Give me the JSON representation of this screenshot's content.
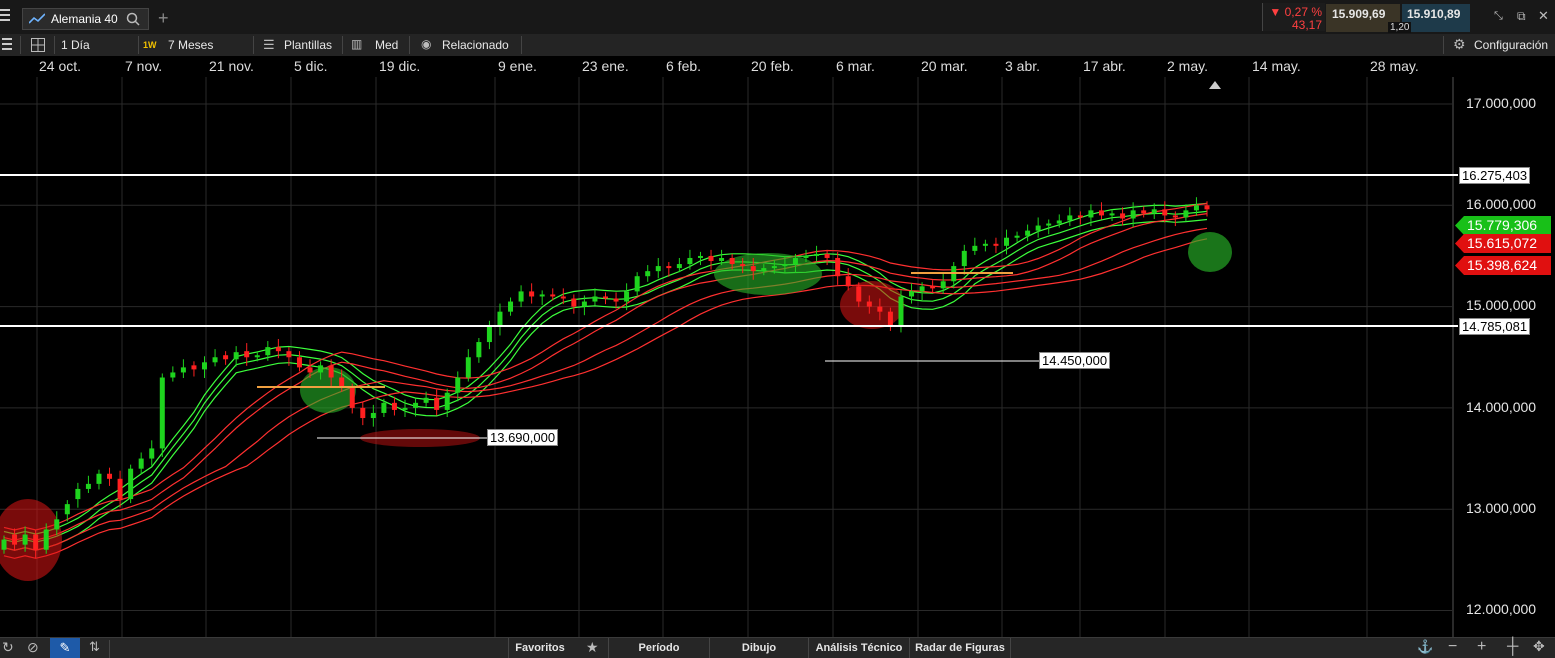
{
  "window": {
    "instrument_tab": "Alemania 40",
    "add_tab_icon": "plus-icon"
  },
  "quote": {
    "change_pct": "▼ 0,27 %",
    "change_pts": "43,17",
    "bid": "15.909,69",
    "ask": "15.910,89",
    "spread": "1,20",
    "colors": {
      "down": "#ff4040",
      "bid_bg": "#3a3426",
      "ask_bg": "#1e3a4a"
    }
  },
  "toolbar": {
    "interval": "1 Día",
    "interval_badge": "1W",
    "range": "7 Meses",
    "templates": "Plantillas",
    "med": "Med",
    "related": "Relacionado",
    "settings": "Configuración"
  },
  "x_axis": {
    "labels": [
      "24 oct.",
      "7 nov.",
      "21 nov.",
      "5 dic.",
      "19 dic.",
      "9 ene.",
      "23 ene.",
      "6 feb.",
      "20 feb.",
      "6 mar.",
      "20 mar.",
      "3 abr.",
      "17 abr.",
      "2 may.",
      "14 may.",
      "28 may."
    ]
  },
  "y_axis": {
    "labels": [
      "17.000,000",
      "16.000,000",
      "15.000,000",
      "14.000,000",
      "13.000,000",
      "12.000,000"
    ]
  },
  "annotations": {
    "resistance": "16.275,403",
    "support": "14.785,081",
    "low1": "13.690,000",
    "low2": "14.450,000"
  },
  "price_tags": {
    "green": "15.779,306",
    "red1": "15.615,072",
    "red2": "15.398,624",
    "colors": {
      "green": "#18c018",
      "red": "#e01010"
    }
  },
  "bottom": {
    "favorites": "Favoritos",
    "period": "Período",
    "drawing": "Dibujo",
    "technical": "Análisis Técnico",
    "patterns": "Radar de Figuras"
  },
  "chart_data": {
    "type": "candlestick",
    "y_range": [
      11950,
      17250
    ],
    "x_labels": [
      "24 oct.",
      "7 nov.",
      "21 nov.",
      "5 dic.",
      "19 dic.",
      "9 ene.",
      "23 ene.",
      "6 feb.",
      "20 feb.",
      "6 mar.",
      "20 mar.",
      "3 abr.",
      "17 abr.",
      "2 may."
    ],
    "close": [
      12700,
      12650,
      12750,
      12600,
      12800,
      12900,
      13050,
      13200,
      13250,
      13350,
      13300,
      13100,
      13400,
      13500,
      13600,
      14300,
      14350,
      14400,
      14380,
      14450,
      14500,
      14480,
      14550,
      14500,
      14520,
      14600,
      14560,
      14500,
      14400,
      14350,
      14420,
      14300,
      14200,
      14000,
      13900,
      13950,
      14050,
      13980,
      14000,
      14050,
      14100,
      13980,
      14150,
      14300,
      14500,
      14650,
      14800,
      14950,
      15050,
      15150,
      15100,
      15120,
      15100,
      15080,
      15000,
      15050,
      15100,
      15080,
      15050,
      15150,
      15300,
      15350,
      15400,
      15380,
      15420,
      15480,
      15500,
      15450,
      15480,
      15420,
      15400,
      15350,
      15380,
      15400,
      15420,
      15480,
      15500,
      15520,
      15480,
      15300,
      15200,
      15050,
      15000,
      14950,
      14800,
      15100,
      15150,
      15200,
      15180,
      15250,
      15400,
      15550,
      15600,
      15620,
      15600,
      15680,
      15700,
      15750,
      15800,
      15820,
      15850,
      15900,
      15880,
      15950,
      15900,
      15920,
      15870,
      15950,
      15920,
      15960,
      15900,
      15880,
      15950,
      16000,
      15960
    ],
    "open": [
      12600,
      12750,
      12650,
      12750,
      12600,
      12800,
      12950,
      13100,
      13200,
      13250,
      13350,
      13300,
      13100,
      13400,
      13500,
      13600,
      14300,
      14350,
      14420,
      14380,
      14450,
      14520,
      14480,
      14560,
      14500,
      14520,
      14600,
      14560,
      14500,
      14400,
      14350,
      14420,
      14300,
      14200,
      14000,
      13900,
      13950,
      14050,
      13980,
      14000,
      14050,
      14100,
      13980,
      14150,
      14300,
      14500,
      14650,
      14800,
      14950,
      15050,
      15150,
      15100,
      15120,
      15100,
      15080,
      15000,
      15050,
      15100,
      15080,
      15050,
      15150,
      15300,
      15350,
      15400,
      15380,
      15420,
      15480,
      15500,
      15450,
      15480,
      15420,
      15400,
      15350,
      15380,
      15400,
      15420,
      15480,
      15500,
      15520,
      15480,
      15300,
      15200,
      15050,
      15000,
      14950,
      14800,
      15100,
      15150,
      15200,
      15180,
      15250,
      15400,
      15550,
      15600,
      15620,
      15600,
      15680,
      15700,
      15750,
      15800,
      15820,
      15850,
      15900,
      15880,
      15950,
      15900,
      15920,
      15870,
      15950,
      15920,
      15960,
      15900,
      15880,
      15950,
      16000
    ],
    "indicators": [
      "moving averages (green)",
      "moving averages (red)"
    ]
  }
}
